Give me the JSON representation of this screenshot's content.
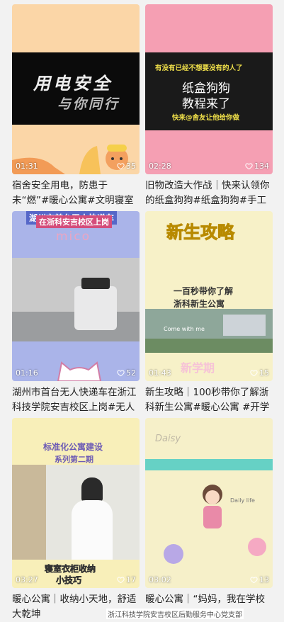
{
  "cards": [
    {
      "duration": "01:31",
      "likes": "35",
      "caption": "宿舍安全用电，防患于未“燃”#暖心公寓#文明寝室#寝室安全",
      "overlay": [
        "用电安全",
        "与你同行"
      ],
      "colors": {
        "bg": "#fbd6a7",
        "band": "#0b0b0b"
      }
    },
    {
      "duration": "02:28",
      "likes": "134",
      "caption": "旧物改造大作战｜快来认领你的纸盒狗狗#纸盒狗狗#手工",
      "overlay": [
        "有没有已经不想要没有的人了",
        "纸盒狗狗",
        "教程来了",
        "快来@舍友让他给你做"
      ],
      "colors": {
        "bg": "#f59fb3",
        "band": "#1a1a1a"
      }
    },
    {
      "duration": "01:16",
      "likes": "52",
      "caption": "湖州市首台无人快递车在浙江科技学院安吉校区上岗#无人快递",
      "overlay": [
        "湖州市首台无人快递车",
        "在浙科安吉校区上岗",
        "mico"
      ],
      "colors": {
        "bg": "#aab4e9",
        "band": "#c9c9c9"
      }
    },
    {
      "duration": "01:43",
      "likes": "15",
      "caption": "新生攻略｜100秒带你了解浙科新生公寓#暖心公寓 #开学季",
      "overlay": [
        "新生攻略",
        "一百秒带你了解",
        "浙科新生公寓",
        "Come with me",
        "新学期"
      ],
      "colors": {
        "bg": "#f7f1c8",
        "band": "#8ea79a"
      }
    },
    {
      "duration": "03:27",
      "likes": "17",
      "caption": "暖心公寓｜收纳小天地，舒适大乾坤",
      "overlay": [
        "标准化公寓建设",
        "系列第二期",
        "寝室衣柜收纳",
        "小技巧"
      ],
      "colors": {
        "bg": "#f8efb9",
        "band": "#e6e6e0"
      }
    },
    {
      "duration": "03:02",
      "likes": "13",
      "caption": "暖心公寓｜“妈妈，我在学校挺好的！”母亲节快乐！",
      "overlay": [
        "Daily life",
        "Daisy"
      ],
      "colors": {
        "bg": "#f6f0c9",
        "band": "#66d1c5"
      }
    }
  ],
  "footer": "浙江科技学院安吉校区后勤服务中心党支部"
}
